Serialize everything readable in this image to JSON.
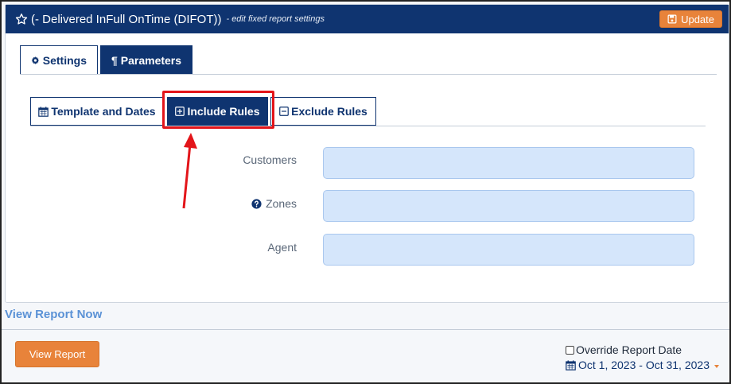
{
  "header": {
    "title": "(- Delivered InFull OnTime (DIFOT))",
    "subtitle": "- edit fixed report settings",
    "update_label": "Update"
  },
  "top_tabs": [
    {
      "label": "Settings",
      "icon": "gear-icon",
      "active": false
    },
    {
      "label": "Parameters",
      "icon": "pilcrow-icon",
      "active": true
    }
  ],
  "sub_tabs": [
    {
      "label": "Template and Dates",
      "icon": "calendar-icon",
      "active": false
    },
    {
      "label": "Include Rules",
      "icon": "plus-square-icon",
      "active": true
    },
    {
      "label": "Exclude Rules",
      "icon": "minus-square-icon",
      "active": false
    }
  ],
  "form": {
    "customers_label": "Customers",
    "customers_value": "",
    "zones_label": "Zones",
    "zones_value": "",
    "agent_label": "Agent",
    "agent_value": ""
  },
  "footer": {
    "view_report_now": "View Report Now",
    "view_report_label": "View Report",
    "override_label": "Override Report Date",
    "override_checked": false,
    "date_range": "Oct 1, 2023 - Oct 31, 2023"
  },
  "colors": {
    "navy": "#0f3470",
    "orange": "#e8833a",
    "input_bg": "#d5e6fb",
    "annotation_red": "#e3151a",
    "link_blue": "#5b92d6"
  }
}
